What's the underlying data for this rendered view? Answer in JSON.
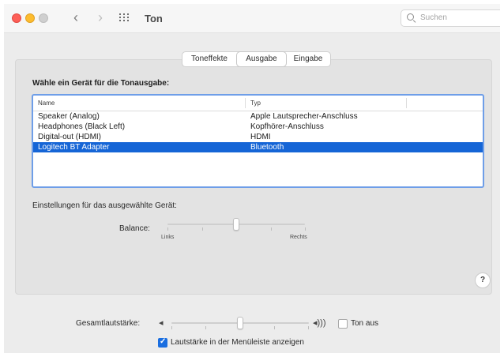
{
  "window": {
    "title": "Ton",
    "search_placeholder": "Suchen"
  },
  "tabs": [
    {
      "label": "Toneffekte",
      "selected": false
    },
    {
      "label": "Ausgabe",
      "selected": true
    },
    {
      "label": "Eingabe",
      "selected": false
    }
  ],
  "output": {
    "heading": "Wähle ein Gerät für die Tonausgabe:",
    "columns": [
      "Name",
      "Typ"
    ],
    "devices": [
      {
        "name": "Speaker (Analog)",
        "type": "Apple Lautsprecher-Anschluss",
        "selected": false
      },
      {
        "name": "Headphones (Black Left)",
        "type": "Kopfhörer-Anschluss",
        "selected": false
      },
      {
        "name": "Digital-out (HDMI)",
        "type": "HDMI",
        "selected": false
      },
      {
        "name": "Logitech BT Adapter",
        "type": "Bluetooth",
        "selected": true
      }
    ],
    "settings_label": "Einstellungen für das ausgewählte Gerät:",
    "balance": {
      "label": "Balance:",
      "left_label": "Links",
      "right_label": "Rechts",
      "value": 0.5
    }
  },
  "help_label": "?",
  "volume": {
    "label": "Gesamtlautstärke:",
    "value": 0.5,
    "mute_label": "Ton aus",
    "mute_checked": false,
    "menubar_label": "Lautstärke in der Menüleiste anzeigen",
    "menubar_checked": true
  },
  "colors": {
    "selection": "#1565d6",
    "focus_ring": "#6e9ee8",
    "checkbox_accent": "#1a6ee0"
  }
}
